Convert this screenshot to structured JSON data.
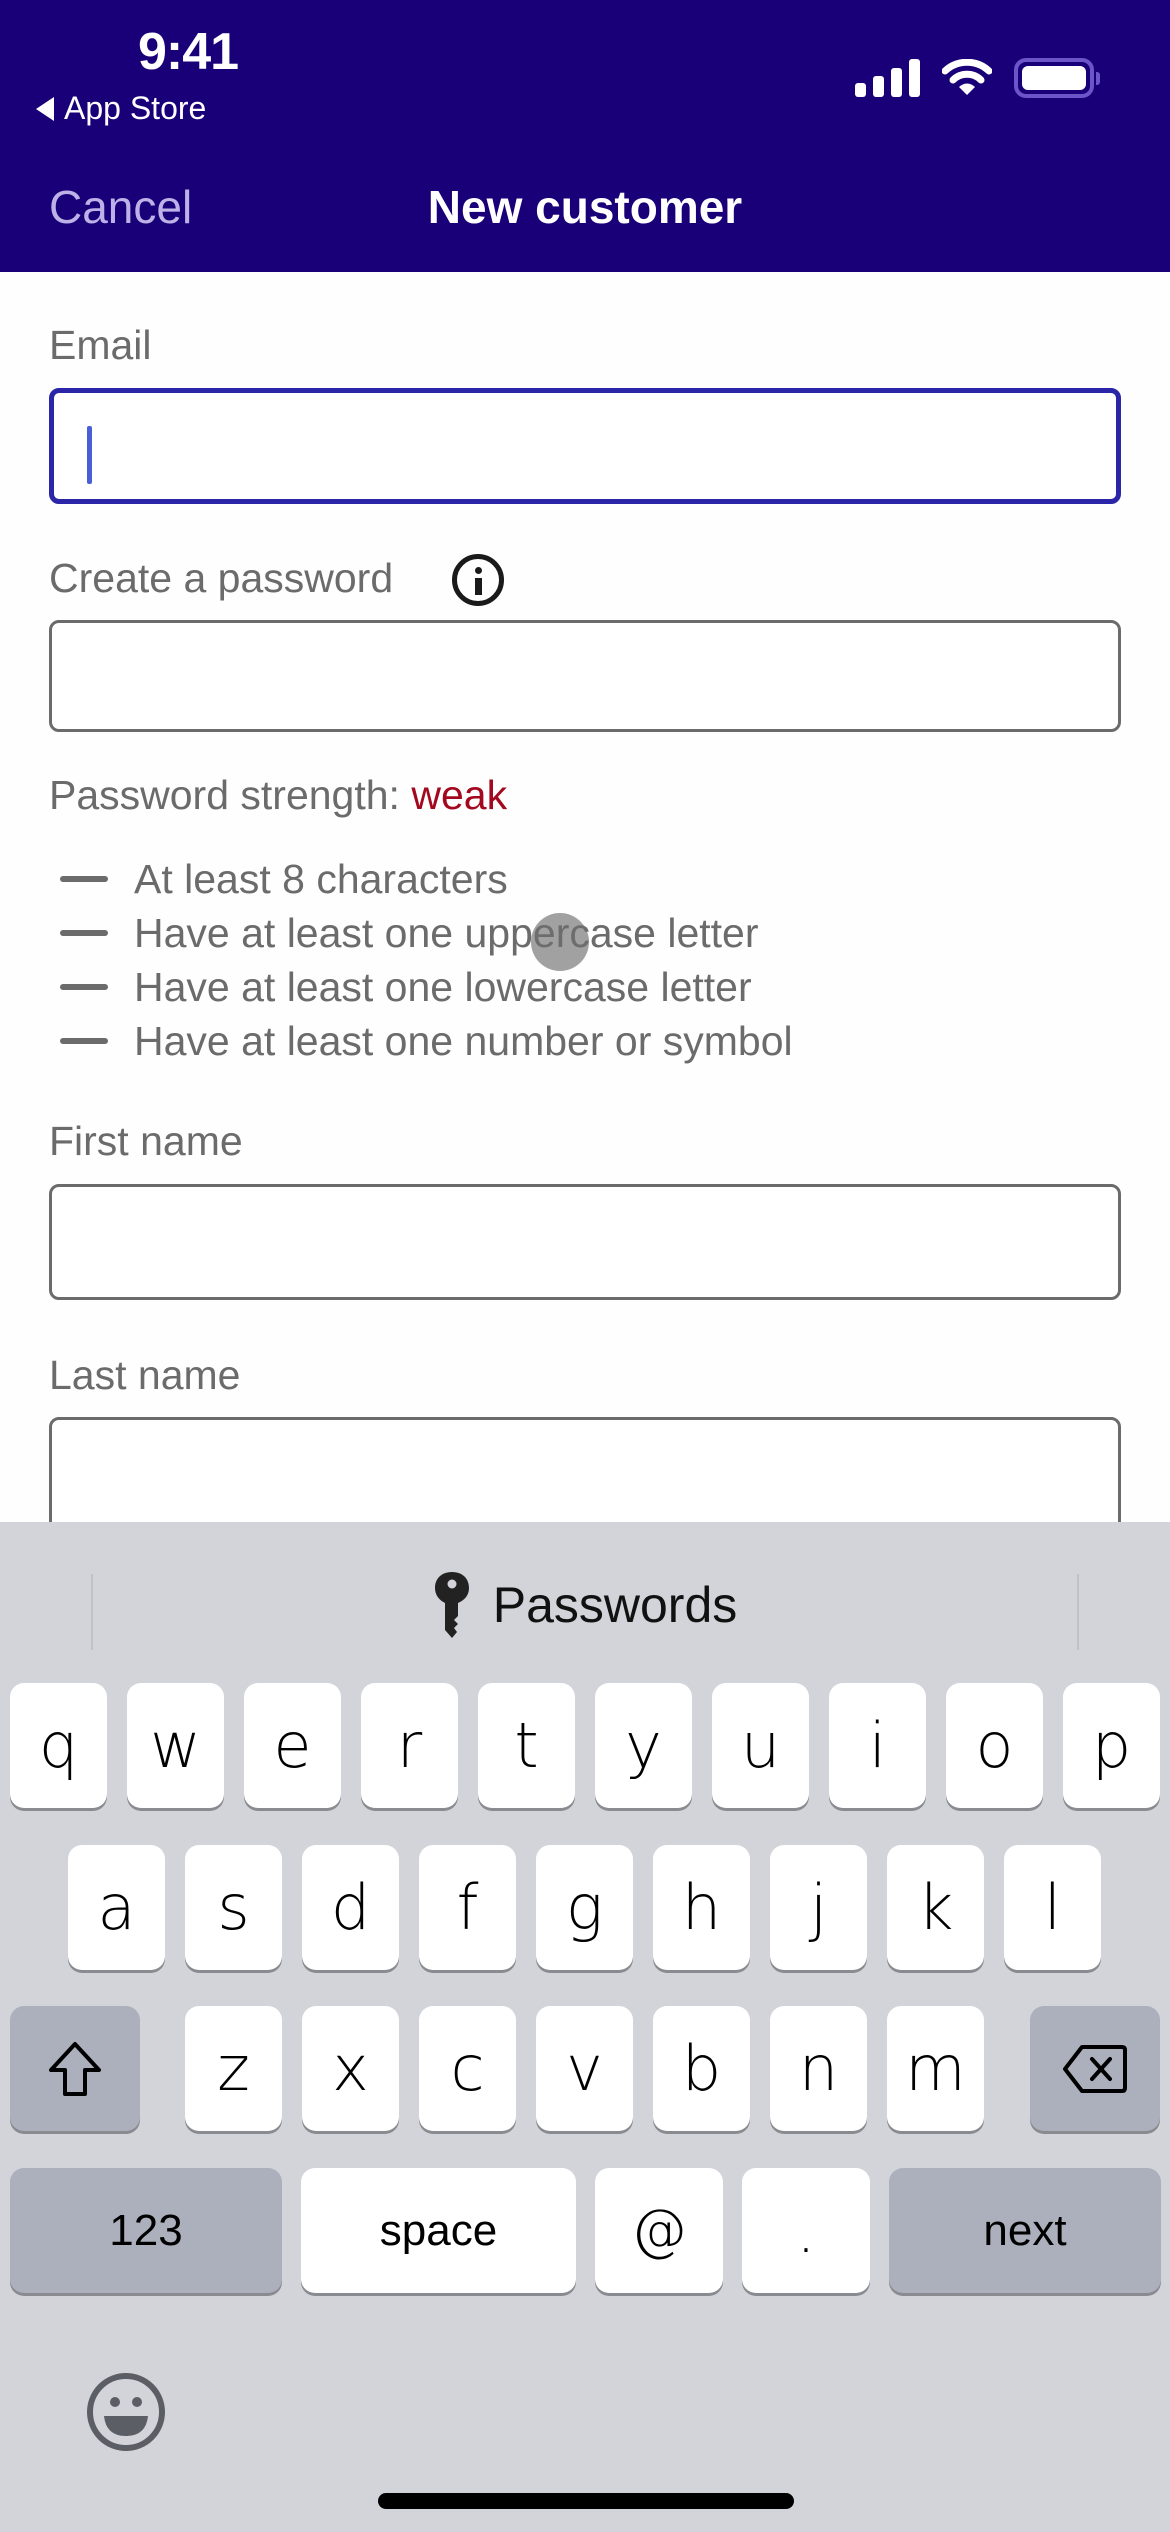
{
  "status_bar": {
    "time": "9:41",
    "back_app": "App Store",
    "icons": [
      "cellular-signal-icon",
      "wifi-icon",
      "battery-icon"
    ]
  },
  "nav": {
    "cancel_label": "Cancel",
    "title": "New customer"
  },
  "form": {
    "email": {
      "label": "Email",
      "value": "",
      "focused": true
    },
    "password": {
      "label": "Create a password",
      "value": "",
      "info_icon": "info-icon"
    },
    "strength": {
      "prefix": "Password strength:",
      "value": "weak",
      "value_color": "#a3091e"
    },
    "rules": [
      "At least 8 characters",
      "Have at least one uppercase letter",
      "Have at least one lowercase letter",
      "Have at least one number or symbol"
    ],
    "first_name": {
      "label": "First name",
      "value": ""
    },
    "last_name": {
      "label": "Last name",
      "value": ""
    }
  },
  "keyboard": {
    "suggestion": {
      "icon": "key-icon",
      "label": "Passwords"
    },
    "row1": [
      "q",
      "w",
      "e",
      "r",
      "t",
      "y",
      "u",
      "i",
      "o",
      "p"
    ],
    "row2": [
      "a",
      "s",
      "d",
      "f",
      "g",
      "h",
      "j",
      "k",
      "l"
    ],
    "row3": [
      "z",
      "x",
      "c",
      "v",
      "b",
      "n",
      "m"
    ],
    "shift_icon": "shift-icon",
    "delete_icon": "delete-icon",
    "numbers_label": "123",
    "space_label": "space",
    "at_label": "@",
    "dot_label": ".",
    "next_label": "next",
    "emoji_icon": "emoji-icon"
  },
  "colors": {
    "brand": "#1a0078",
    "focus_border": "#2b25a8",
    "weak": "#a3091e"
  }
}
